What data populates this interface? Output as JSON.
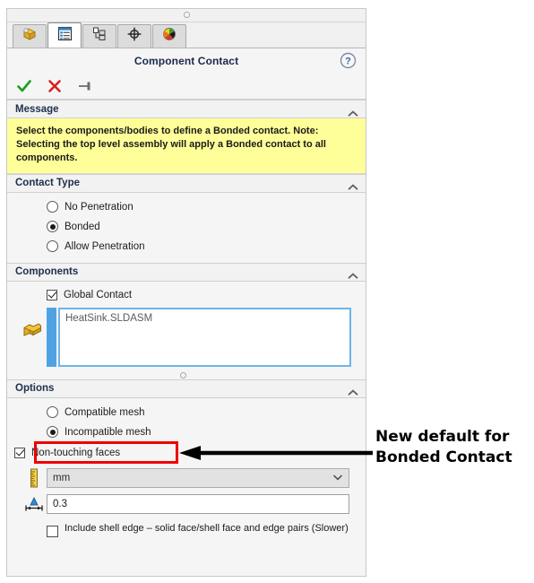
{
  "panel": {
    "title": "Component Contact",
    "help_icon": "help-circle-icon",
    "accept_icon": "green-check-icon",
    "cancel_icon": "red-x-icon",
    "pin_icon": "pushpin-icon"
  },
  "tabs": [
    {
      "name": "feature-manager",
      "icon": "yellow-cube-icon",
      "active": false
    },
    {
      "name": "property-manager",
      "icon": "blue-list-icon",
      "active": true
    },
    {
      "name": "configuration-manager",
      "icon": "configurations-icon",
      "active": false
    },
    {
      "name": "dimxpert-manager",
      "icon": "crosshair-target-icon",
      "active": false
    },
    {
      "name": "display-manager",
      "icon": "color-sphere-icon",
      "active": false
    }
  ],
  "sections": {
    "message": {
      "title": "Message",
      "text": "Select the components/bodies to define a Bonded contact. Note: Selecting the top level assembly will apply a Bonded contact to all components."
    },
    "contact_type": {
      "title": "Contact Type",
      "options": [
        {
          "label": "No Penetration",
          "selected": false
        },
        {
          "label": "Bonded",
          "selected": true
        },
        {
          "label": "Allow Penetration",
          "selected": false
        }
      ]
    },
    "components": {
      "title": "Components",
      "global_contact_label": "Global Contact",
      "global_contact_checked": true,
      "component_icon": "components-solid-icon",
      "selection_item": "HeatSink.SLDASM"
    },
    "options": {
      "title": "Options",
      "mesh_options": [
        {
          "label": "Compatible mesh",
          "selected": false
        },
        {
          "label": "Incompatible mesh",
          "selected": true
        }
      ],
      "non_touching_label": "Non-touching faces",
      "non_touching_checked": true,
      "unit_icon": "ruler-icon",
      "unit_value": "mm",
      "gap_icon": "gap-distance-icon",
      "gap_value": "0.3",
      "shell_edge_label": "Include shell edge – solid face/shell face and edge pairs (Slower)",
      "shell_edge_checked": false
    }
  },
  "annotation": {
    "line1": "New default for",
    "line2": "Bonded Contact",
    "highlight_color": "#ee0000",
    "arrow_color": "#000000"
  }
}
